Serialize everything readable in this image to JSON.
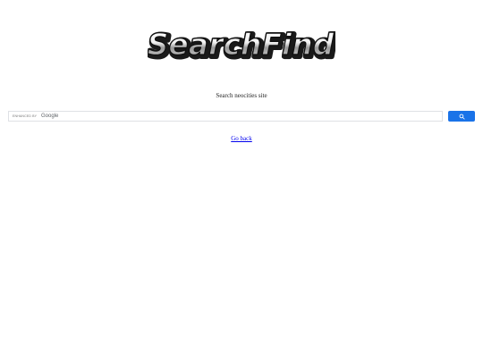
{
  "logo": {
    "text": "SearchFind"
  },
  "subtitle": "Search neocities site",
  "search": {
    "enhanced_label": "ENHANCED BY",
    "google_label": "Google",
    "value": "",
    "placeholder": "",
    "button_icon": "search-icon",
    "button_color": "#1a73e8"
  },
  "nav": {
    "go_back_label": "Go back",
    "link_color": "#0000ee"
  }
}
